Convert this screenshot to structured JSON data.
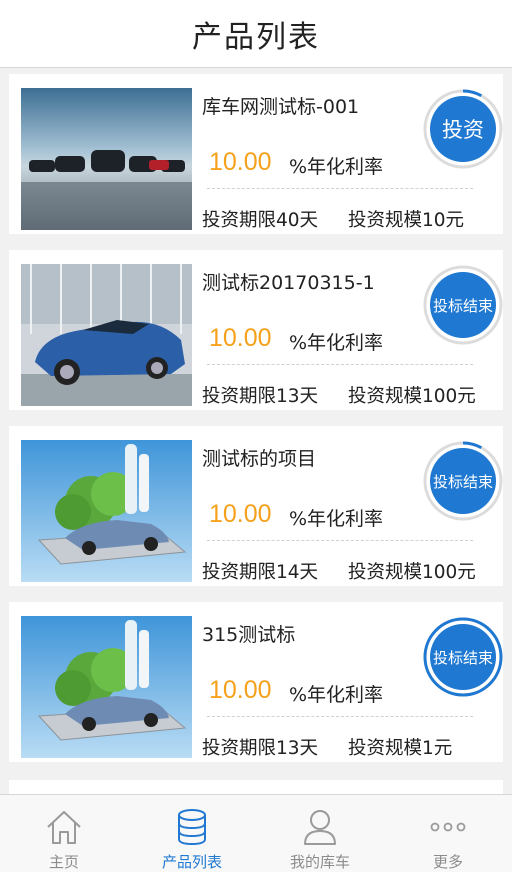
{
  "header": {
    "title": "产品列表"
  },
  "products": [
    {
      "name": "库车网测试标-001",
      "rate": "10.00",
      "rate_unit": "%年化利率",
      "term": "投资期限40天",
      "scale": "投资规模10元",
      "button": "投资",
      "status": "invest",
      "progress": 0.08
    },
    {
      "name": "测试标20170315-1",
      "rate": "10.00",
      "rate_unit": "%年化利率",
      "term": "投资期限13天",
      "scale": "投资规模100元",
      "button": "投标结束",
      "status": "ended",
      "progress": 0.0
    },
    {
      "name": "测试标的项目",
      "rate": "10.00",
      "rate_unit": "%年化利率",
      "term": "投资期限14天",
      "scale": "投资规模100元",
      "button": "投标结束",
      "status": "ended",
      "progress": 0.08
    },
    {
      "name": "315测试标",
      "rate": "10.00",
      "rate_unit": "%年化利率",
      "term": "投资期限13天",
      "scale": "投资规模1元",
      "button": "投标结束",
      "status": "ended",
      "progress": 1.0
    }
  ],
  "tabbar": {
    "items": [
      {
        "label": "主页",
        "icon": "home-icon",
        "active": false
      },
      {
        "label": "产品列表",
        "icon": "database-icon",
        "active": true
      },
      {
        "label": "我的库车",
        "icon": "user-icon",
        "active": false
      },
      {
        "label": "更多",
        "icon": "more-icon",
        "active": false
      }
    ]
  },
  "colors": {
    "accent": "#1f78d1",
    "rate": "#f5a11c",
    "ring_track": "#dcdcdc"
  }
}
